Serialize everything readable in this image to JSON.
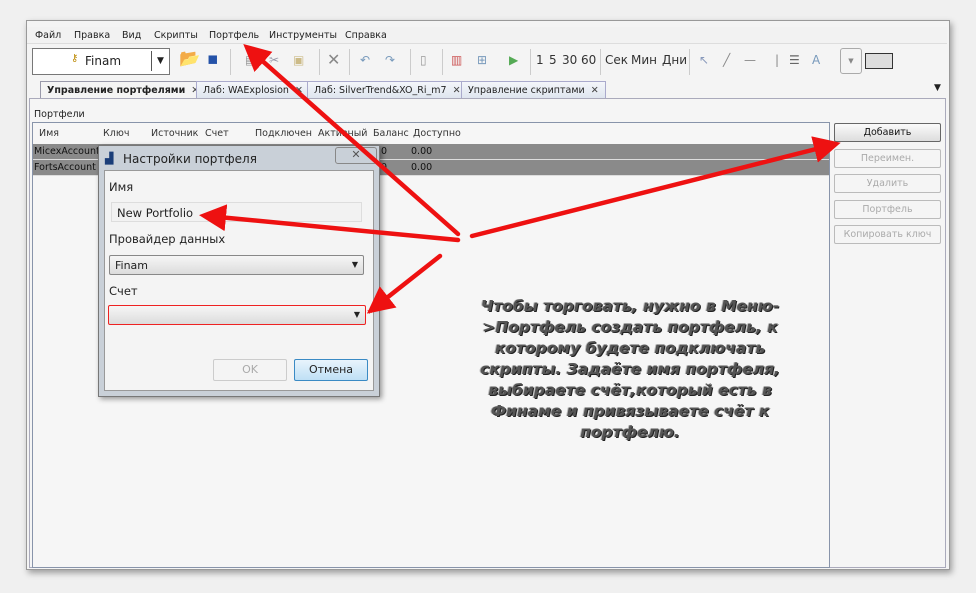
{
  "menu": [
    "Файл",
    "Правка",
    "Вид",
    "Скрипты",
    "Портфель",
    "Инструменты",
    "Справка"
  ],
  "toolbar": {
    "account": "Finam",
    "timeframes": [
      "1",
      "5",
      "30",
      "60"
    ],
    "units": [
      "Сек",
      "Мин",
      "Дни"
    ]
  },
  "tabs": [
    {
      "label": "Управление портфелями"
    },
    {
      "label": "Лаб: WAExplosion"
    },
    {
      "label": "Лаб: SilverTrend&XO_Ri_m7"
    },
    {
      "label": "Управление скриптами"
    }
  ],
  "section": "Портфели",
  "table": {
    "columns": [
      "Имя",
      "Ключ",
      "Источник",
      "Счет",
      "Подключен",
      "Активный",
      "Баланс",
      "Доступно"
    ],
    "rows": [
      {
        "name": "MicexAccount",
        "balance": "0",
        "available": "0.00"
      },
      {
        "name": "FortsAccount",
        "balance": "0",
        "available": "0.00"
      }
    ]
  },
  "buttons": {
    "add": "Добавить",
    "rename": "Переимен.",
    "delete": "Удалить",
    "portfolio": "Портфель",
    "copy_key": "Копировать ключ"
  },
  "dialog": {
    "title": "Настройки портфеля",
    "name_label": "Имя",
    "name_value": "New Portfolio",
    "provider_label": "Провайдер данных",
    "provider_value": "Finam",
    "account_label": "Счет",
    "account_value": "",
    "required": "*",
    "ok": "OK",
    "cancel": "Отмена"
  },
  "annotation": "Чтобы торговать, нужно в Меню->Портфель создать портфель, к которому будете подключать скрипты. Задаёте имя портфеля, выбираете счёт,который есть в Финаме и привязываете счёт к портфелю.",
  "colors": {
    "arrow": "#ee1111",
    "selected_row": "#8a8a8a"
  }
}
